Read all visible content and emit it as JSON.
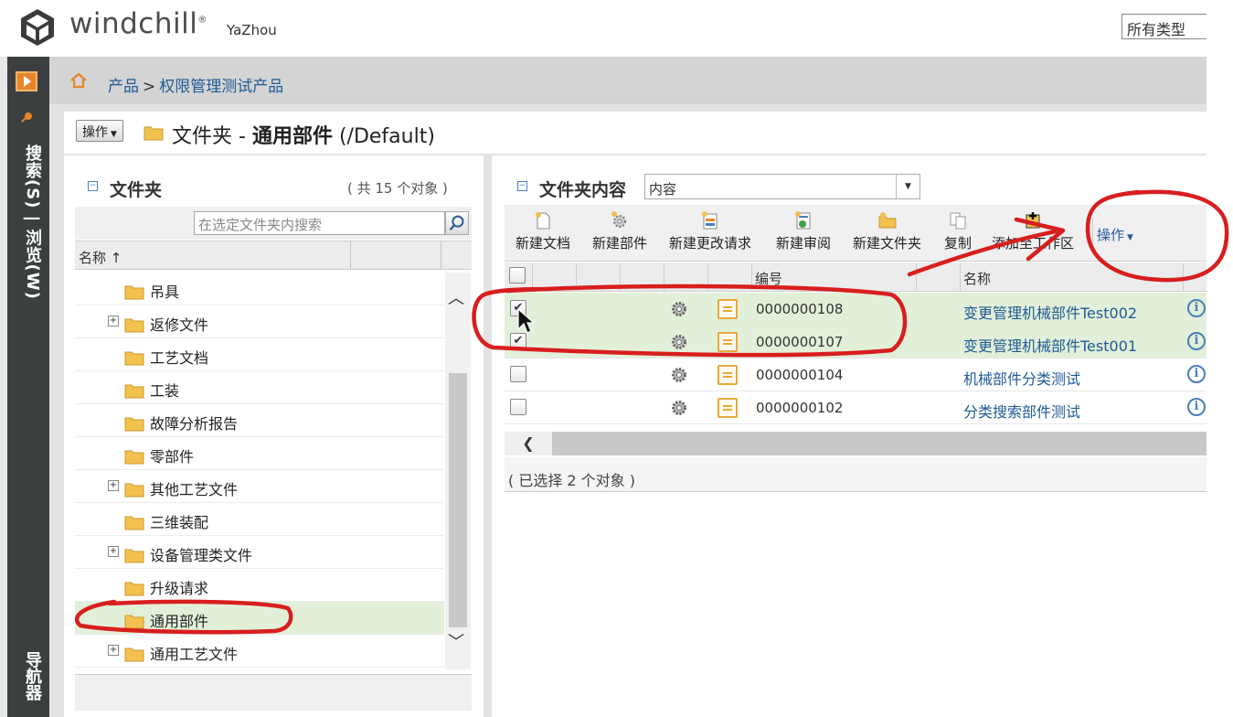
{
  "header": {
    "logo_text": "windchill",
    "logo_mark": "®",
    "user": "YaZhou",
    "type_filter": "所有类型"
  },
  "left_nav": {
    "search_browse": "搜索(S) | 浏览(W)",
    "navigator": "导航器"
  },
  "breadcrumb": {
    "root": "产品",
    "separator": ">",
    "current": "权限管理测试产品"
  },
  "title_bar": {
    "actions_label": "操作",
    "title_prefix": "文件夹 - ",
    "title_bold": "通用部件",
    "title_suffix": " (/Default)"
  },
  "folder_panel": {
    "title": "文件夹",
    "count": "( 共 15 个对象 )",
    "search_placeholder": "在选定文件夹内搜索",
    "column_name": "名称 ↑",
    "folders": [
      {
        "label": "吊具",
        "expandable": false,
        "selected": false
      },
      {
        "label": "返修文件",
        "expandable": true,
        "selected": false
      },
      {
        "label": "工艺文档",
        "expandable": false,
        "selected": false
      },
      {
        "label": "工装",
        "expandable": false,
        "selected": false
      },
      {
        "label": "故障分析报告",
        "expandable": false,
        "selected": false
      },
      {
        "label": "零部件",
        "expandable": false,
        "selected": false
      },
      {
        "label": "其他工艺文件",
        "expandable": true,
        "selected": false
      },
      {
        "label": "三维装配",
        "expandable": false,
        "selected": false
      },
      {
        "label": "设备管理类文件",
        "expandable": true,
        "selected": false
      },
      {
        "label": "升级请求",
        "expandable": false,
        "selected": false
      },
      {
        "label": "通用部件",
        "expandable": false,
        "selected": true
      },
      {
        "label": "通用工艺文件",
        "expandable": true,
        "selected": false
      }
    ]
  },
  "content_panel": {
    "title": "文件夹内容",
    "view_select": "内容",
    "toolbar": [
      {
        "label": "新建文档",
        "icon": "new-document-icon"
      },
      {
        "label": "新建部件",
        "icon": "new-part-icon"
      },
      {
        "label": "新建更改请求",
        "icon": "new-change-request-icon"
      },
      {
        "label": "新建审阅",
        "icon": "new-review-icon"
      },
      {
        "label": "新建文件夹",
        "icon": "new-folder-icon"
      },
      {
        "label": "复制",
        "icon": "copy-icon"
      },
      {
        "label": "添加至工作区",
        "icon": "add-to-workspace-icon"
      }
    ],
    "actions_label": "操作",
    "columns": {
      "number": "编号",
      "name": "名称"
    },
    "rows": [
      {
        "checked": true,
        "number": "0000000108",
        "name": "变更管理机械部件Test002"
      },
      {
        "checked": true,
        "number": "0000000107",
        "name": "变更管理机械部件Test001"
      },
      {
        "checked": false,
        "number": "0000000104",
        "name": "机械部件分类测试"
      },
      {
        "checked": false,
        "number": "0000000102",
        "name": "分类搜索部件测试"
      }
    ],
    "selected_status": "( 已选择 2 个对象 )"
  },
  "colors": {
    "nav_dark": "#3c3f40",
    "link_blue": "#1f5a96",
    "selection_green": "#e2f0d9",
    "annotation_red": "#d81e1e",
    "folder_yellow": "#f2c14e"
  }
}
